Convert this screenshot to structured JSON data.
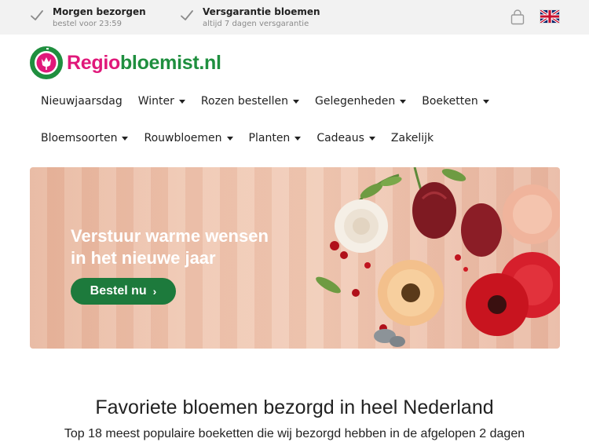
{
  "topbar": {
    "usps": [
      {
        "title": "Morgen bezorgen",
        "subtitle": "bestel voor 23:59",
        "icon": "check-icon"
      },
      {
        "title": "Versgarantie bloemen",
        "subtitle": "altijd 7 dagen versgarantie",
        "icon": "check-icon"
      }
    ],
    "cart_icon": "shopping-bag-icon",
    "language_icon": "uk-flag-icon"
  },
  "header": {
    "logo_part1": "Regio",
    "logo_part2": "bloemist.nl",
    "brand_colors": {
      "pink": "#e0187a",
      "green": "#1f8f3f"
    }
  },
  "nav": {
    "row1": [
      {
        "label": "Nieuwjaarsdag",
        "dropdown": false
      },
      {
        "label": "Winter",
        "dropdown": true
      },
      {
        "label": "Rozen bestellen",
        "dropdown": true
      },
      {
        "label": "Gelegenheden",
        "dropdown": true
      },
      {
        "label": "Boeketten",
        "dropdown": true
      }
    ],
    "row2": [
      {
        "label": "Bloemsoorten",
        "dropdown": true
      },
      {
        "label": "Rouwbloemen",
        "dropdown": true
      },
      {
        "label": "Planten",
        "dropdown": true
      },
      {
        "label": "Cadeaus",
        "dropdown": true
      },
      {
        "label": "Zakelijk",
        "dropdown": false
      }
    ]
  },
  "hero": {
    "title_line1": "Verstuur warme wensen",
    "title_line2": "in het nieuwe jaar",
    "button_label": "Bestel nu",
    "button_icon": "chevron-right-icon",
    "button_color": "#1d7a3c"
  },
  "section": {
    "title": "Favoriete bloemen bezorgd in heel Nederland",
    "subtitle": "Top 18 meest populaire boeketten die wij bezorgd hebben in de afgelopen 2 dagen"
  }
}
